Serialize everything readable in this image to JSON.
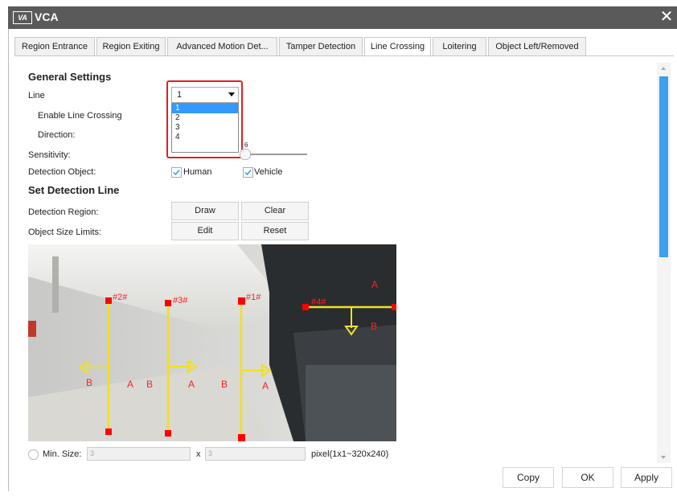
{
  "window": {
    "logo": "VA",
    "title": "VCA",
    "close_glyph": "✕"
  },
  "tabs": [
    {
      "label": "Region Entrance"
    },
    {
      "label": "Region Exiting"
    },
    {
      "label": "Advanced Motion Det..."
    },
    {
      "label": "Tamper Detection"
    },
    {
      "label": "Line Crossing",
      "active": true
    },
    {
      "label": "Loitering"
    },
    {
      "label": "Object Left/Removed"
    }
  ],
  "general": {
    "heading": "General Settings",
    "line_label": "Line",
    "line_value": "1",
    "line_options": [
      "1",
      "2",
      "3",
      "4"
    ],
    "enable_label": "Enable Line Crossing",
    "direction_label": "Direction:",
    "sensitivity_label": "Sensitivity:",
    "sensitivity_value": "6",
    "detection_object_label": "Detection Object:",
    "human_label": "Human",
    "human_checked": true,
    "vehicle_label": "Vehicle",
    "vehicle_checked": true
  },
  "detection_line": {
    "heading": "Set Detection Line",
    "region_label": "Detection Region:",
    "draw_label": "Draw",
    "clear_label": "Clear",
    "size_limits_label": "Object Size Limits:",
    "edit_label": "Edit",
    "reset_label": "Reset"
  },
  "preview": {
    "line_labels": [
      "#1#",
      "#2#",
      "#3#",
      "#4#"
    ],
    "side_a": "A",
    "side_b": "B",
    "line_color": "#f0e020",
    "marker_color": "#ff0000"
  },
  "min_size": {
    "label": "Min. Size:",
    "width_value": "3",
    "x_sep": "x",
    "height_value": "3",
    "range_hint": "pixel(1x1~320x240)"
  },
  "footer": {
    "copy_label": "Copy",
    "ok_label": "OK",
    "apply_label": "Apply"
  },
  "colors": {
    "accent": "#3399ff",
    "scrollbar": "#3aa0ef",
    "highlight": "#e02020",
    "titlebar": "#5a5a5a"
  }
}
